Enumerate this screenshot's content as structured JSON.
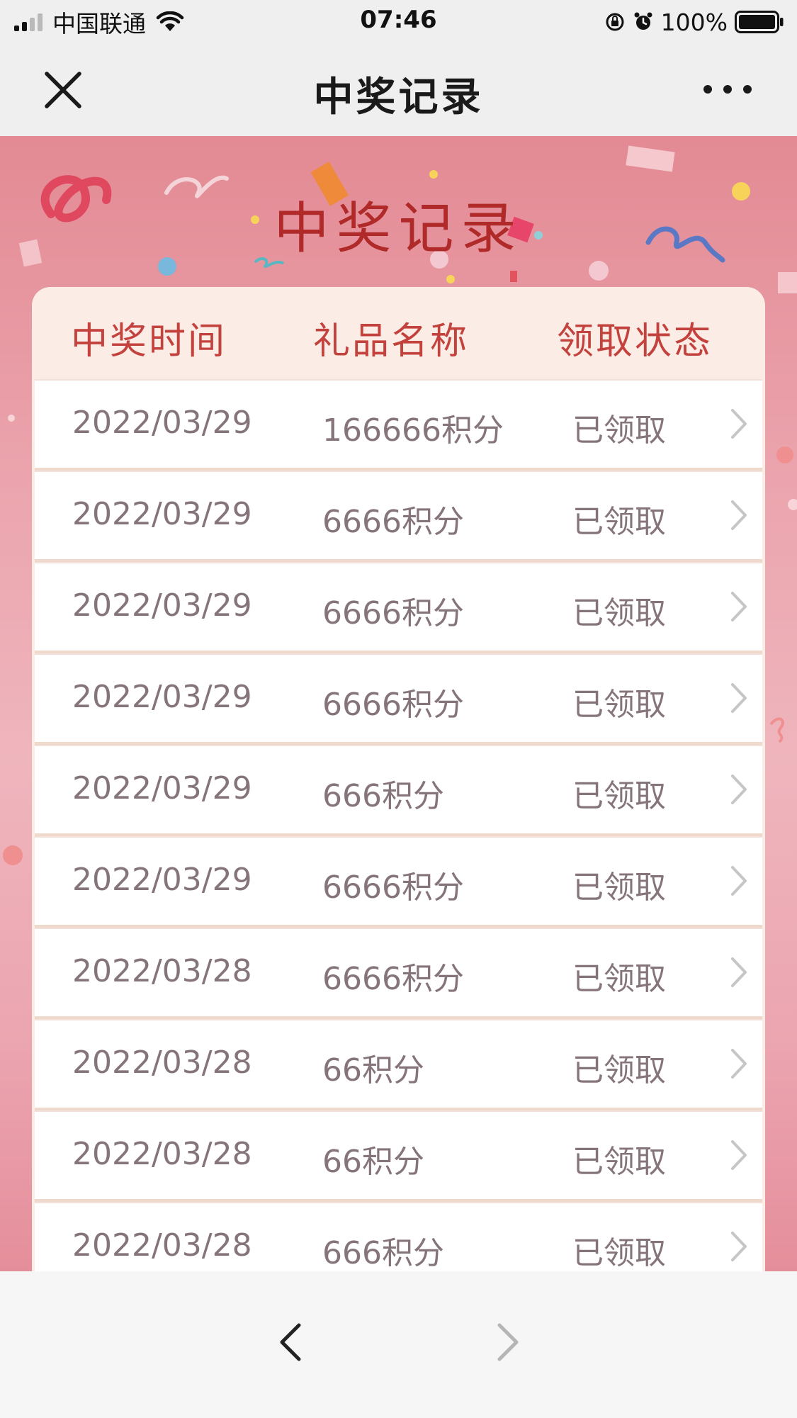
{
  "status_bar": {
    "carrier": "中国联通",
    "time": "07:46",
    "battery": "100%"
  },
  "nav": {
    "title": "中奖记录",
    "close_icon": "close-icon",
    "more_icon": "more-icon"
  },
  "banner": {
    "title": "中奖记录"
  },
  "table": {
    "headers": {
      "time": "中奖时间",
      "gift": "礼品名称",
      "status": "领取状态"
    },
    "rows": [
      {
        "date": "2022/03/29",
        "gift": "166666积分",
        "status": "已领取"
      },
      {
        "date": "2022/03/29",
        "gift": "6666积分",
        "status": "已领取"
      },
      {
        "date": "2022/03/29",
        "gift": "6666积分",
        "status": "已领取"
      },
      {
        "date": "2022/03/29",
        "gift": "6666积分",
        "status": "已领取"
      },
      {
        "date": "2022/03/29",
        "gift": "666积分",
        "status": "已领取"
      },
      {
        "date": "2022/03/29",
        "gift": "6666积分",
        "status": "已领取"
      },
      {
        "date": "2022/03/28",
        "gift": "6666积分",
        "status": "已领取"
      },
      {
        "date": "2022/03/28",
        "gift": "66积分",
        "status": "已领取"
      },
      {
        "date": "2022/03/28",
        "gift": "66积分",
        "status": "已领取"
      },
      {
        "date": "2022/03/28",
        "gift": "666积分",
        "status": "已领取"
      }
    ]
  },
  "toolbar": {
    "back_icon": "chevron-left-icon",
    "forward_icon": "chevron-right-icon"
  },
  "colors": {
    "accent": "#c4423d",
    "row_text": "#85757a",
    "background_pink": "#eba4ad"
  }
}
